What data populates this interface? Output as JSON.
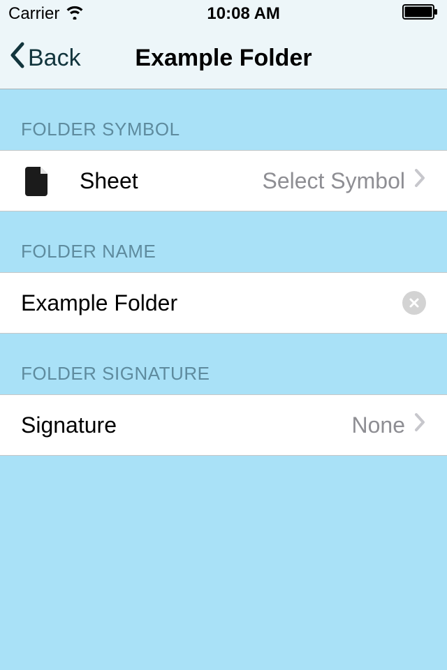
{
  "statusBar": {
    "carrier": "Carrier",
    "time": "10:08 AM"
  },
  "nav": {
    "backLabel": "Back",
    "title": "Example Folder"
  },
  "sections": {
    "symbol": {
      "header": "FOLDER SYMBOL",
      "name": "Sheet",
      "action": "Select Symbol"
    },
    "name": {
      "header": "FOLDER NAME",
      "value": "Example Folder"
    },
    "signature": {
      "header": "FOLDER SIGNATURE",
      "label": "Signature",
      "value": "None"
    }
  }
}
